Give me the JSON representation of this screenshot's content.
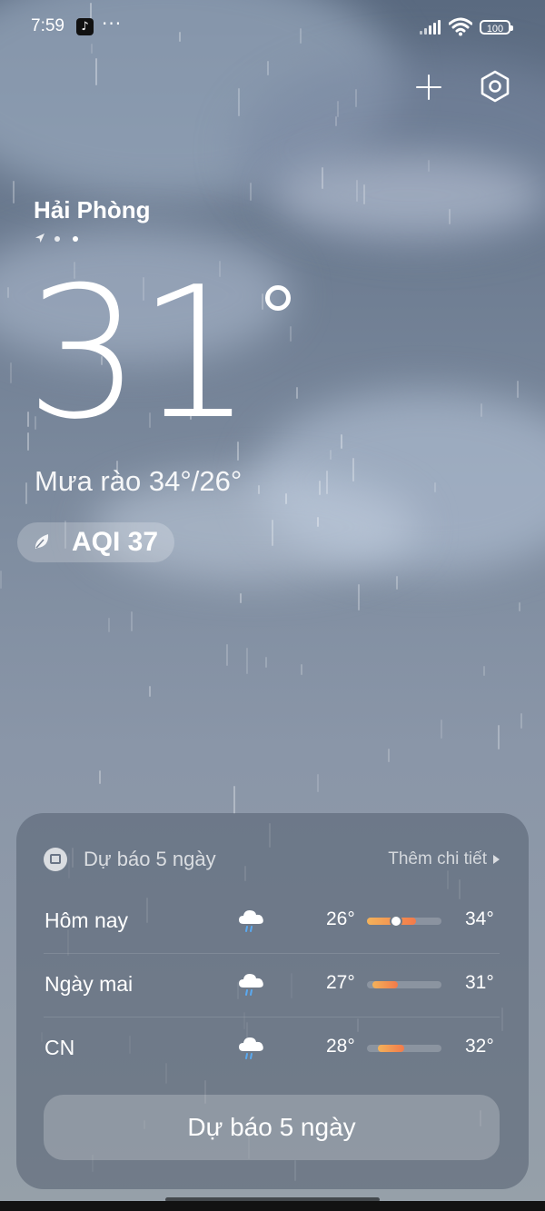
{
  "status_bar": {
    "time": "7:59",
    "notif_more": "···",
    "battery": "100",
    "icons": [
      "tiktok-icon",
      "signal-icon",
      "wifi-icon",
      "battery-icon"
    ]
  },
  "top_actions": {
    "add_icon": "plus-icon",
    "settings_icon": "settings-hexagon-icon"
  },
  "location": {
    "city": "Hải Phòng",
    "pager_dots": 2,
    "active_page": 0
  },
  "current": {
    "temperature": "31",
    "condition_range": "Mưa rào  34°/26°",
    "aqi_label": "AQI 37"
  },
  "forecast": {
    "title": "Dự báo 5 ngày",
    "more_link": "Thêm chi tiết",
    "rows": [
      {
        "day": "Hôm nay",
        "icon": "cloud-rain-icon",
        "low": "26°",
        "high": "34°",
        "bar_start": 0.0,
        "bar_end": 0.66,
        "now": 0.39
      },
      {
        "day": "Ngày mai",
        "icon": "cloud-rain-icon",
        "low": "27°",
        "high": "31°",
        "bar_start": 0.07,
        "bar_end": 0.42
      },
      {
        "day": "CN",
        "icon": "cloud-rain-icon",
        "low": "28°",
        "high": "32°",
        "bar_start": 0.15,
        "bar_end": 0.5
      }
    ],
    "button_label": "Dự báo 5 ngày"
  },
  "colors": {
    "temp_bar_start": "#f3b25a",
    "temp_bar_end": "#f37a4a",
    "sky_top": "#5a6a80",
    "sky_bottom": "#96a0a9"
  }
}
